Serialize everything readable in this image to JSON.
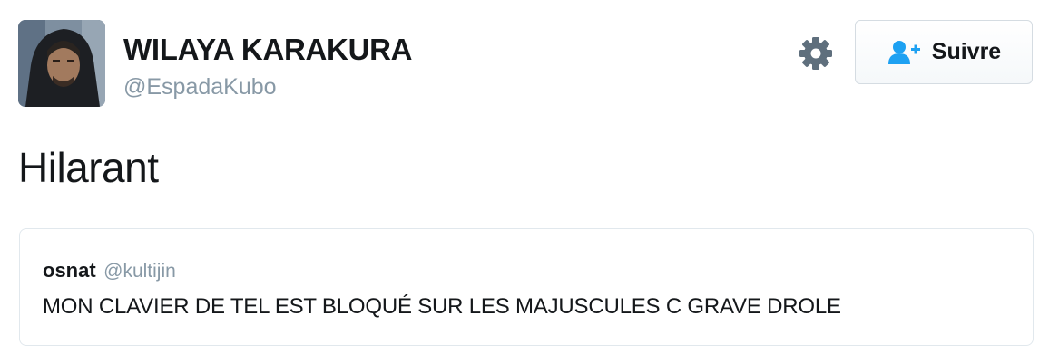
{
  "author": {
    "display_name": "WILAYA KARAKURA",
    "handle": "@EspadaKubo",
    "avatar_icon": "profile-photo"
  },
  "actions": {
    "settings_icon": "gear-icon",
    "follow_label": "Suivre",
    "follow_icon": "add-user-icon",
    "accent_color": "#1da1f2"
  },
  "tweet": {
    "text": "Hilarant"
  },
  "quoted_tweet": {
    "name": "osnat",
    "handle": "@kultijin",
    "text": "MON CLAVIER DE TEL EST BLOQUÉ SUR LES MAJUSCULES C GRAVE DROLE"
  }
}
